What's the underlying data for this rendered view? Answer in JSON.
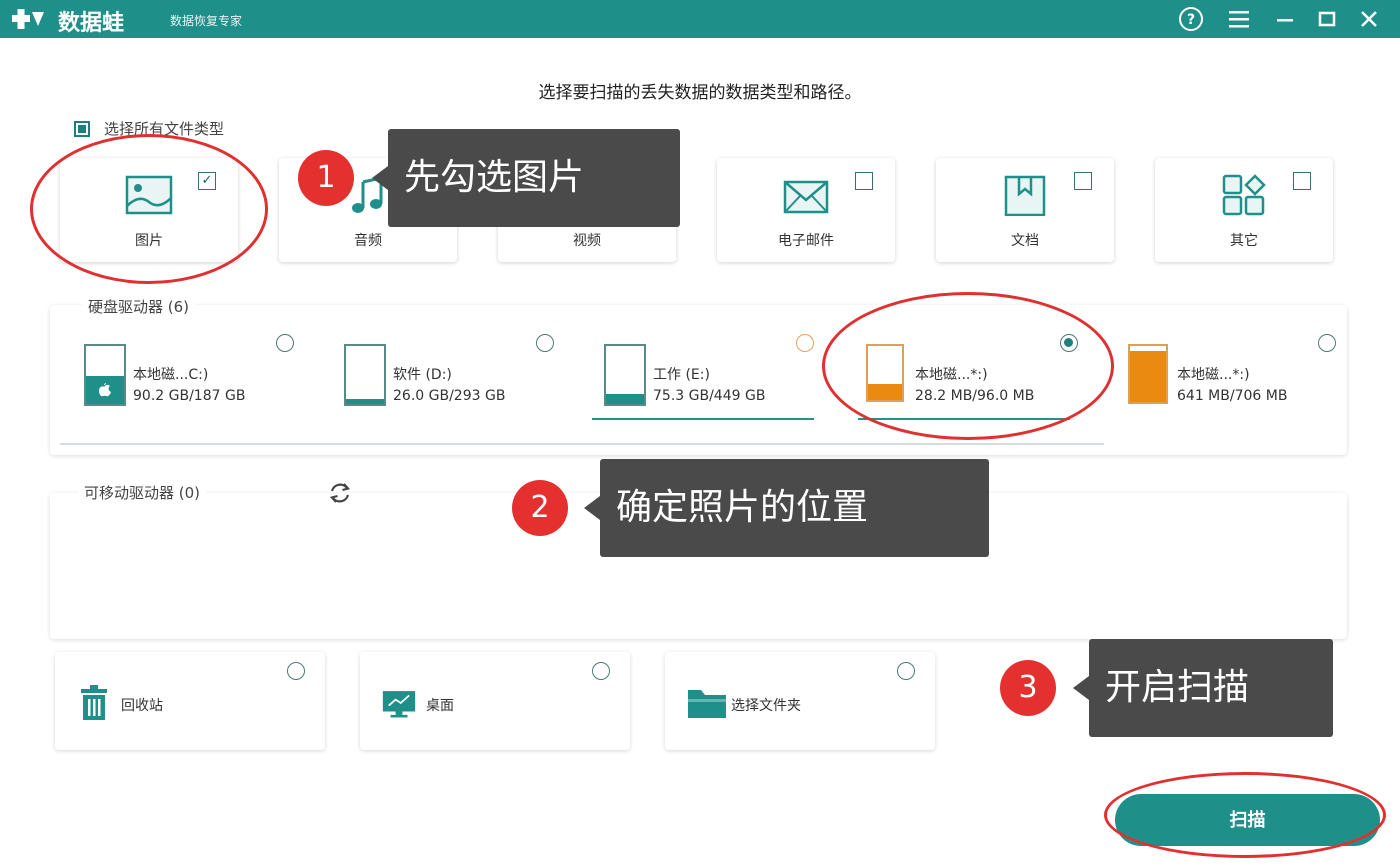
{
  "app": {
    "name": "数据蛙",
    "subtitle": "数据恢复专家"
  },
  "main": {
    "heading": "选择要扫描的丢失数据的数据类型和路径。",
    "select_all_label": "选择所有文件类型"
  },
  "file_types": [
    {
      "label": "图片",
      "icon": "image-icon",
      "checked": true
    },
    {
      "label": "音频",
      "icon": "music-icon",
      "checked": false
    },
    {
      "label": "视频",
      "icon": "video-icon",
      "checked": false
    },
    {
      "label": "电子邮件",
      "icon": "mail-icon",
      "checked": false
    },
    {
      "label": "文档",
      "icon": "document-icon",
      "checked": false
    },
    {
      "label": "其它",
      "icon": "other-icon",
      "checked": false
    }
  ],
  "drives": {
    "title": "硬盘驱动器 (6)",
    "items": [
      {
        "name": "本地磁...C:)",
        "size": "90.2 GB/187 GB",
        "fill_percent": 48,
        "color": "#1f8f8a",
        "selected": false,
        "icon": "windows-drive-icon"
      },
      {
        "name": "软件 (D:)",
        "size": "26.0 GB/293 GB",
        "fill_percent": 9,
        "color": "#1f8f8a",
        "selected": false,
        "icon": "drive-icon"
      },
      {
        "name": "工作 (E:)",
        "size": "75.3 GB/449 GB",
        "fill_percent": 17,
        "color": "#1f8f8a",
        "selected": false,
        "icon": "drive-icon"
      },
      {
        "name": "本地磁...*:)",
        "size": "28.2 MB/96.0 MB",
        "fill_percent": 29,
        "color": "#ea8a10",
        "selected": true,
        "icon": "drive-icon"
      },
      {
        "name": "本地磁...*:)",
        "size": "641 MB/706 MB",
        "fill_percent": 91,
        "color": "#ea8a10",
        "selected": false,
        "icon": "drive-icon"
      }
    ]
  },
  "removable": {
    "title": "可移动驱动器 (0)"
  },
  "locations": [
    {
      "label": "回收站",
      "icon": "trash-icon"
    },
    {
      "label": "桌面",
      "icon": "desktop-icon"
    },
    {
      "label": "选择文件夹",
      "icon": "folder-icon"
    }
  ],
  "scan_button": {
    "label": "扫描"
  },
  "annotations": [
    {
      "number": "1",
      "text": "先勾选图片"
    },
    {
      "number": "2",
      "text": "确定照片的位置"
    },
    {
      "number": "3",
      "text": "开启扫描"
    }
  ],
  "colors": {
    "accent": "#1f8f8a",
    "orange": "#ea8a10",
    "annotation_red": "#e03030",
    "callout_bg": "#4a4a4a"
  }
}
